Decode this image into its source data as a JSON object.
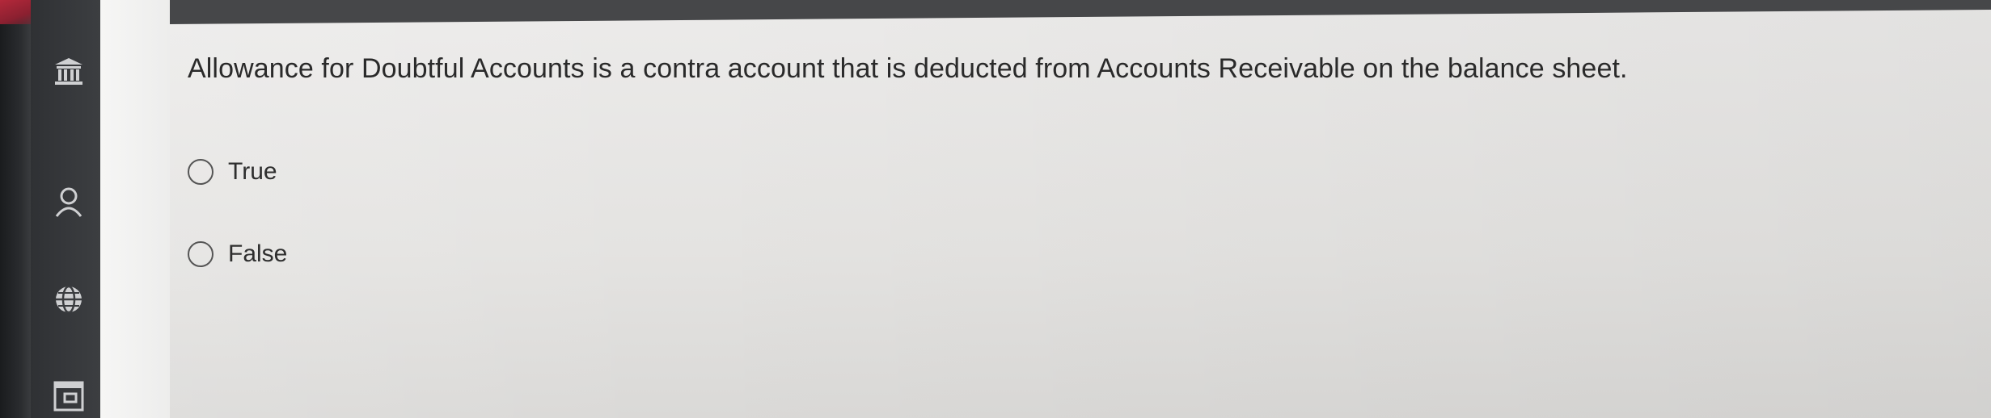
{
  "question": {
    "text": "Allowance for Doubtful Accounts is a contra account that is deducted from Accounts Receivable on the balance sheet."
  },
  "options": [
    {
      "label": "True",
      "selected": false
    },
    {
      "label": "False",
      "selected": false
    }
  ],
  "sidebar": {
    "icons": [
      "institution-icon",
      "user-icon",
      "globe-icon",
      "calendar-icon"
    ]
  },
  "colors": {
    "sidebar": "#3a3c3f",
    "text": "#2a2a2a",
    "background": "#e6e6e4"
  }
}
